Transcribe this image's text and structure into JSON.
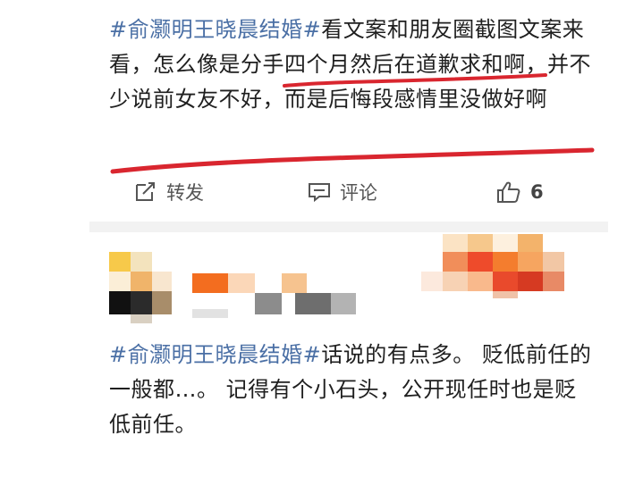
{
  "post1": {
    "hashtag": "#俞灏明王晓晨结婚#",
    "text": "看文案和朋友圈截图文案来看，怎么像是分手四个月然后在道歉求和啊，并不少说前女友不好，而是后悔段感情里没做好啊"
  },
  "actions": {
    "repost_label": "转发",
    "comment_label": "评论",
    "like_count": "6"
  },
  "post2": {
    "hashtag": "#俞灏明王晓晨结婚#",
    "text": "话说的有点多。 贬低前任的一般都…。 记得有个小石头，公开现任时也是贬低前任。"
  },
  "colors": {
    "hashtag": "#4a6fa5",
    "annotation_red": "#d9262f"
  },
  "icons": [
    "repost-icon",
    "comment-icon",
    "like-icon"
  ]
}
